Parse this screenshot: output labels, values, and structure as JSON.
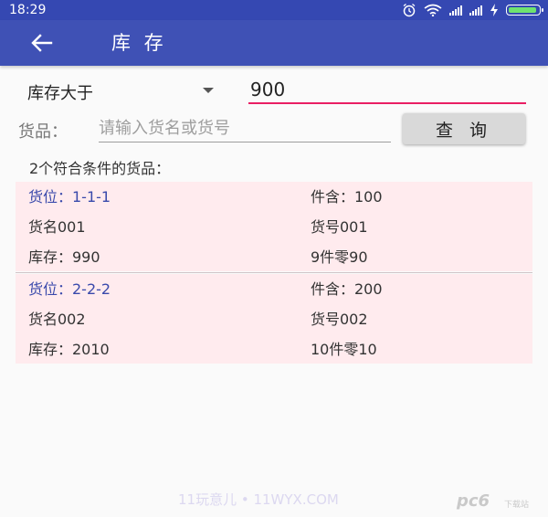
{
  "status_bar": {
    "time": "18:29",
    "icons": [
      "alarm-icon",
      "wifi-icon",
      "signal-icon",
      "signal-icon",
      "charging-icon",
      "battery-icon"
    ],
    "signal_label": "..ıll"
  },
  "app_bar": {
    "title": "库 存",
    "back_icon": "arrow-left-icon"
  },
  "filter": {
    "spinner_selected": "库存大于",
    "value": "900"
  },
  "search": {
    "label": "货品：",
    "placeholder": "请输入货名或货号",
    "button_label": "查 询"
  },
  "result_count": "2个符合条件的货品：",
  "results": [
    {
      "location": "货位：1-1-1",
      "per_box": "件含：100",
      "name": "货名001",
      "code": "货号001",
      "stock": "库存：990",
      "breakdown": "9件零90"
    },
    {
      "location": "货位：2-2-2",
      "per_box": "件含：200",
      "name": "货名002",
      "code": "货号002",
      "stock": "库存：2010",
      "breakdown": "10件零10"
    }
  ],
  "watermarks": {
    "site": "11玩意儿 • 11WYX.COM",
    "brand": "pc6",
    "brand_sub": "下载站"
  },
  "colors": {
    "app_bar": "#3f51b5",
    "status_bar": "#3548b2",
    "accent": "#e91e63",
    "card_bg": "#ffebee",
    "location_text": "#3949ab"
  }
}
